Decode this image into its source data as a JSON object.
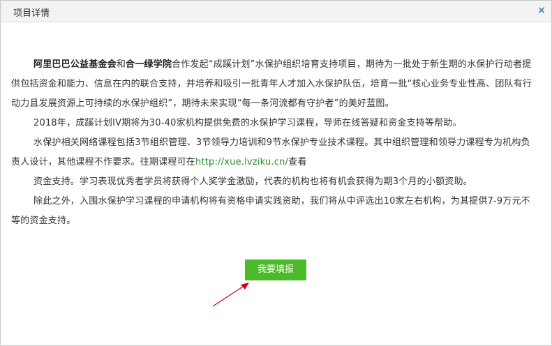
{
  "dialog": {
    "title": "项目详情",
    "close_glyph": "×"
  },
  "content": {
    "p1_org1": "阿里巴巴公益基金会",
    "p1_and": "和",
    "p1_org2": "合一绿学院",
    "p1_rest": "合作发起“成蹊计划”水保护组织培育支持项目，期待为一批处于新生期的水保护行动者提供包括资金和能力、信息在内的联合支持，并培养和吸引一批青年人才加入水保护队伍，培育一批“核心业务专业性高、团队有行动力且发展资源上可持续的水保护组织”，期待未来实现“每一条河流都有守护者”的美好蓝图。",
    "p2": "2018年，成蹊计划IV期将为30-40家机构提供免费的水保护学习课程，导师在线答疑和资金支持等帮助。",
    "p3_text": "水保护相关网络课程包括3节组织管理、3节领导力培训和9节水保护专业技术课程。其中组织管理和领导力课程专为机构负责人设计，其他课程不作要求。往期课程可在",
    "p3_link": "http://xue.lvziku.cn/",
    "p3_after": "查看",
    "p4": "资金支持。学习表现优秀者学员将获得个人奖学金激励，代表的机构也将有机会获得为期3个月的小额资助。",
    "p5": "除此之外，入围水保护学习课程的申请机构将有资格申请实践资助，我们将从中评选出10家左右机构，为其提供7-9万元不等的资金支持。"
  },
  "apply_button": {
    "label": "我要填报",
    "color": "#4cba2a"
  },
  "annotation": {
    "arrow_color": "#d0021b"
  }
}
